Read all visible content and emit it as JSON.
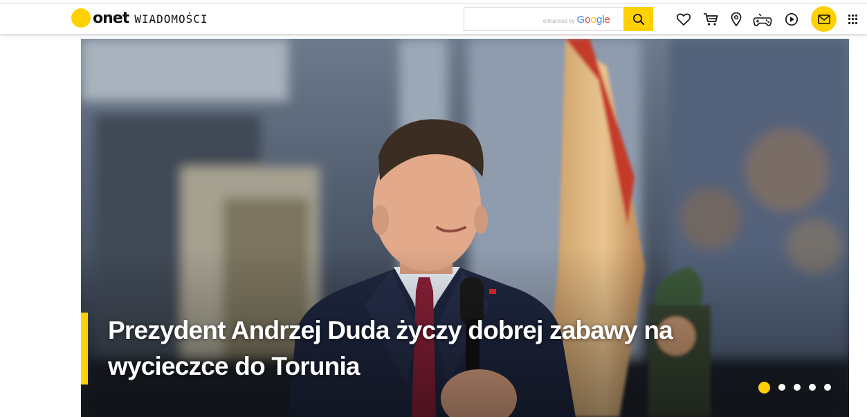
{
  "logo": {
    "wordmark": "onet",
    "section": "WIADOMOŚCI"
  },
  "search": {
    "placeholder": "",
    "enhanced_by": "enhanced by",
    "google": "Google"
  },
  "header_icons": [
    "heart-icon",
    "cart-icon",
    "location-pin-icon",
    "gamepad-icon",
    "play-icon",
    "mail-icon",
    "apps-grid-icon"
  ],
  "hero": {
    "headline_line1": "Prezydent Andrzej Duda życzy dobrej zabawy na",
    "headline_line2": "wycieczce do Torunia",
    "slides_total": 5,
    "active_slide": 1
  },
  "colors": {
    "accent": "#ffd100",
    "text": "#111111"
  }
}
